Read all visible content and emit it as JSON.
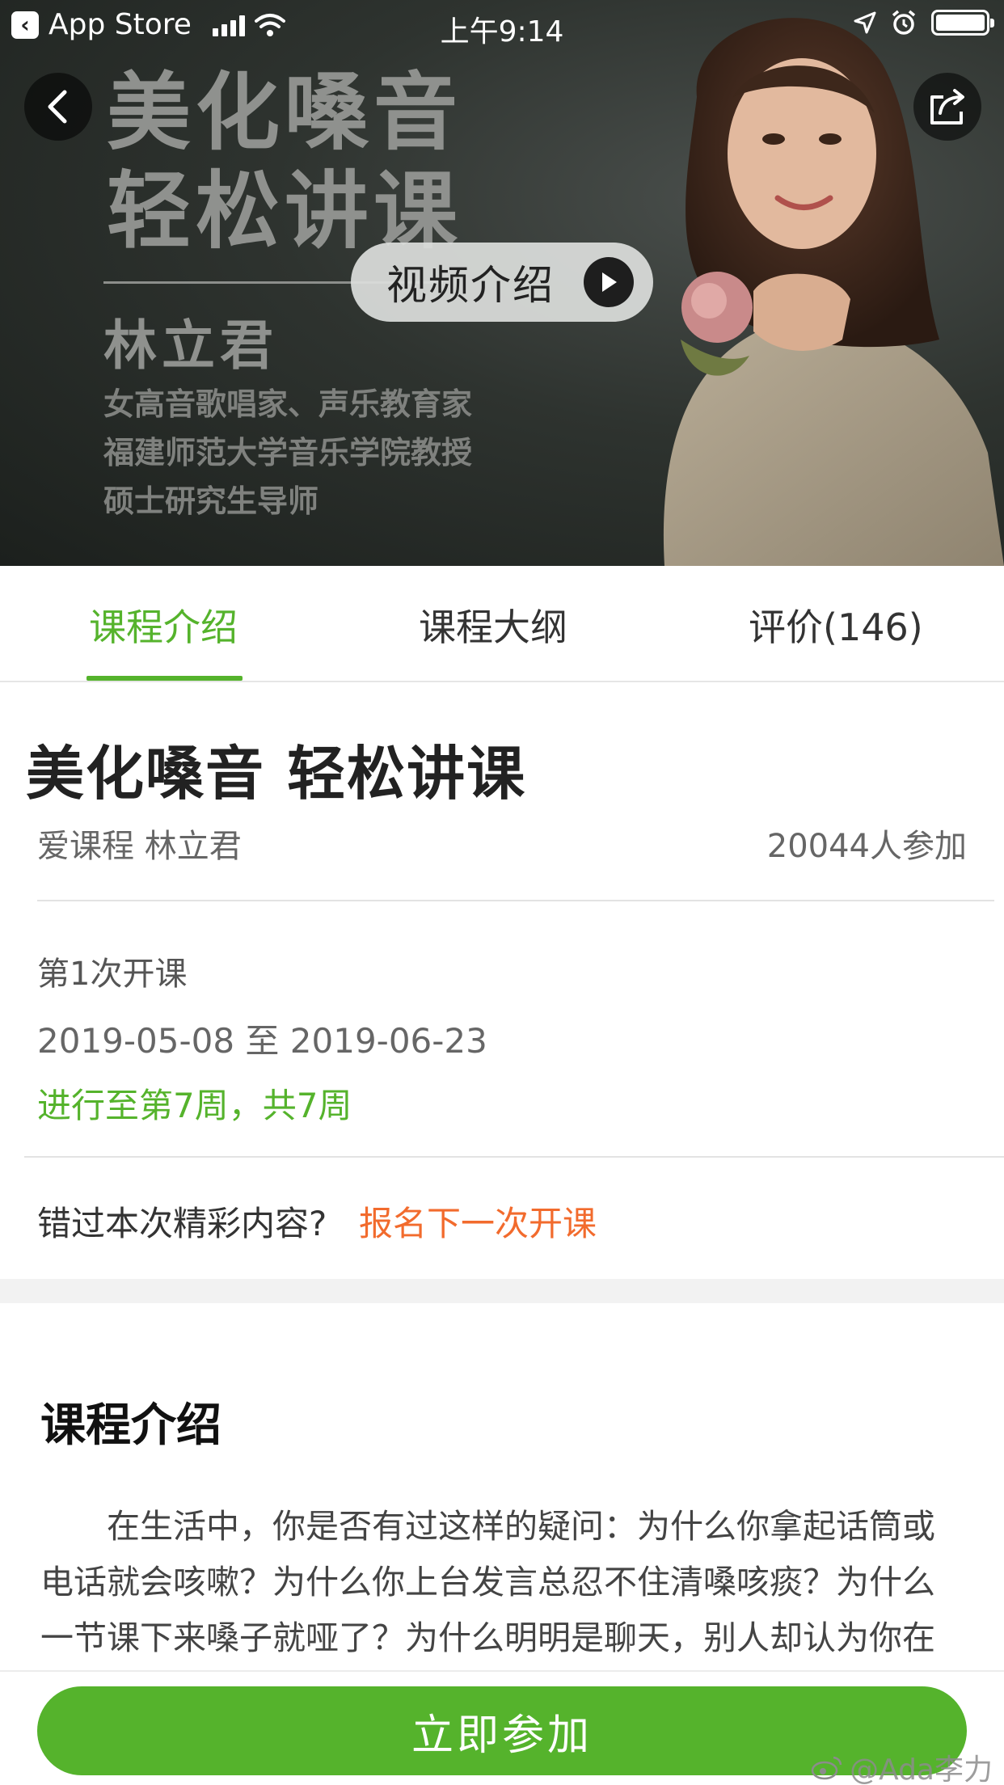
{
  "status_bar": {
    "back_app": "App Store",
    "time": "上午9:14"
  },
  "hero": {
    "title_line1": "美化嗓音",
    "title_line2": "轻松讲课",
    "teacher_name": "林立君",
    "desc_line1": "女高音歌唱家、声乐教育家",
    "desc_line2": "福建师范大学音乐学院教授",
    "desc_line3": "硕士研究生导师",
    "video_button": "视频介绍",
    "icons": {
      "back": "chevron-left-icon",
      "share": "share-icon",
      "play": "play-icon"
    }
  },
  "tabs": [
    {
      "label": "课程介绍",
      "active": true
    },
    {
      "label": "课程大纲",
      "active": false
    },
    {
      "label": "评价(146)",
      "active": false
    }
  ],
  "course": {
    "title": "美化嗓音 轻松讲课",
    "meta": "爱课程  林立君",
    "participants": "20044人参加",
    "session_label": "第1次开课",
    "session_dates": "2019-05-08 至 2019-06-23",
    "progress": "进行至第7周，共7周",
    "missed_label": "错过本次精彩内容?",
    "missed_link": "报名下一次开课"
  },
  "intro": {
    "heading": "课程介绍",
    "body": "在生活中，你是否有过这样的疑问：为什么你拿起话筒或电话就会咳嗽？为什么你上台发言总忍不住清嗓咳痰？为什么一节课下来嗓子就哑了？为什么明明是聊天，别人却认为你在"
  },
  "footer": {
    "join_button": "立即参加",
    "watermark": "@Ada李力"
  },
  "colors": {
    "accent_green": "#55b32c",
    "link_orange": "#f26b2d"
  }
}
